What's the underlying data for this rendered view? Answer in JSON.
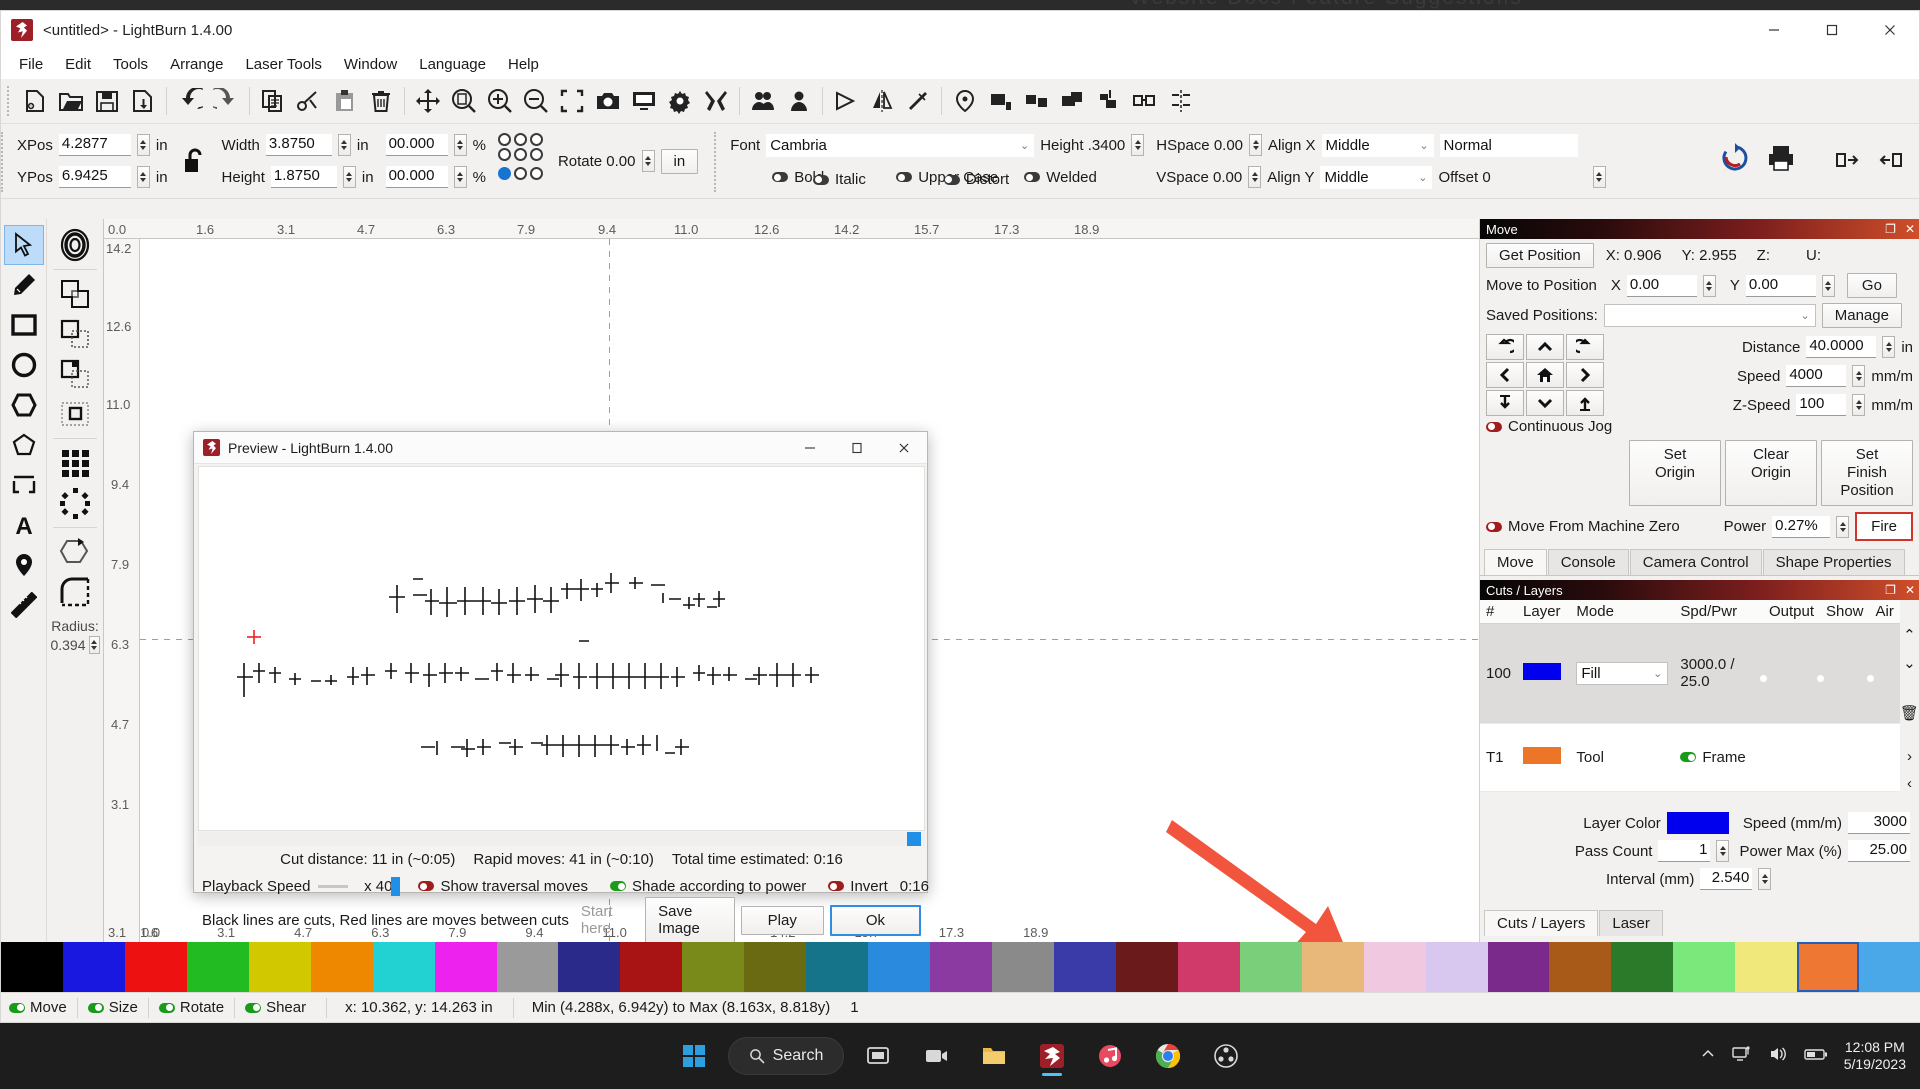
{
  "background_window": {
    "tabs_text": "Website    Docs    Feature Suggestions"
  },
  "window": {
    "title": "<untitled> - LightBurn 1.4.00",
    "controls": {
      "minimize": "minimize-icon",
      "maximize": "maximize-icon",
      "close": "close-icon"
    }
  },
  "menubar": {
    "items": [
      "File",
      "Edit",
      "Tools",
      "Arrange",
      "Laser Tools",
      "Window",
      "Language",
      "Help"
    ]
  },
  "toolbar": {
    "icons": [
      "new-file-icon",
      "open-file-icon",
      "save-icon",
      "save-as-icon",
      "undo-icon",
      "redo-icon",
      "copy-icon",
      "cut-icon",
      "paste-icon",
      "delete-icon",
      "move-icon",
      "zoom-fit-icon",
      "zoom-in-icon",
      "zoom-out-icon",
      "frame-selection-icon",
      "camera-icon",
      "monitor-icon",
      "settings-icon",
      "device-settings-icon",
      "group-icon",
      "ungroup-icon",
      "mirror-icon",
      "flip-horizontal-icon",
      "flip-vertical-icon",
      "node-edit-icon",
      "offset-icon",
      "weld-icon",
      "boolean-union-icon",
      "boolean-subtract-icon",
      "array-icon",
      "align-icon"
    ]
  },
  "properties": {
    "xpos_label": "XPos",
    "xpos_value": "4.2877",
    "xpos_unit": "in",
    "ypos_label": "YPos",
    "ypos_value": "6.9425",
    "ypos_unit": "in",
    "width_label": "Width",
    "width_value": "3.8750",
    "width_unit": "in",
    "height_label": "Height",
    "height_value": "1.8750",
    "height_unit": "in",
    "width_pct": "00.000",
    "height_pct": "00.000",
    "pct_unit": "%",
    "rotate_label": "Rotate 0.00",
    "rotate_unit": "in",
    "lock_icon": "unlocked-padlock-icon"
  },
  "text_toolbar": {
    "font_label": "Font",
    "font_value": "Cambria",
    "height_label": "Height .3400",
    "bold": "Bold",
    "italic": "Italic",
    "upper_case": "Upper Case",
    "distort": "Distort",
    "welded": "Welded",
    "hspace": "HSpace 0.00",
    "vspace": "VSpace 0.00",
    "align_x": "Align X",
    "align_x_value": "Middle",
    "align_y": "Align Y",
    "align_y_value": "Middle",
    "normal": "Normal",
    "offset": "Offset 0"
  },
  "left_tools": {
    "primary": [
      "select-arrow-icon",
      "pencil-draw-icon",
      "rectangle-icon",
      "ellipse-icon",
      "polygon-icon",
      "pen-path-icon",
      "bracket-frame-icon",
      "text-tool-icon",
      "position-pin-icon",
      "measure-ruler-icon"
    ],
    "secondary": [
      "offset-shapes-icon",
      "boolean-union-icon",
      "boolean-subtract-icon",
      "boolean-intersect-icon",
      "boolean-xor-icon",
      "grid-array-icon",
      "circular-array-icon",
      "edit-nodes-icon",
      "round-corner-icon"
    ],
    "radius_label": "Radius:",
    "radius_value": "0.394"
  },
  "rulers": {
    "horizontal": [
      "0.0",
      "1.6",
      "3.1",
      "4.7",
      "6.3",
      "7.9",
      "9.4",
      "11.0",
      "12.6",
      "14.2",
      "15.7",
      "17.3",
      "18.9"
    ],
    "vertical": [
      "14.2",
      "12.6",
      "11.0",
      "9.4",
      "7.9",
      "6.3",
      "4.7",
      "3.1"
    ],
    "origin_left": "0.0",
    "origin_bottom": "0.0"
  },
  "preview_dialog": {
    "title": "Preview - LightBurn 1.4.00",
    "stats": {
      "cut_distance": "Cut distance: 11 in (~0:05)",
      "rapid_moves": "Rapid moves: 41 in (~0:10)",
      "total_time": "Total time estimated: 0:16"
    },
    "playback_speed_label": "Playback Speed",
    "playback_multiplier": "x 40",
    "show_traversal": "Show traversal moves",
    "show_traversal_state": "off",
    "shade_power": "Shade according to power",
    "shade_power_state": "on",
    "invert": "Invert",
    "invert_state": "off",
    "invert_time": "0:16",
    "legend": "Black lines are cuts, Red lines are moves between cuts",
    "buttons": {
      "start_here": "Start here",
      "save_image": "Save Image",
      "play": "Play",
      "ok": "Ok"
    }
  },
  "move_panel": {
    "header": "Move",
    "get_position": "Get Position",
    "pos_x": "X: 0.906",
    "pos_y": "Y: 2.955",
    "pos_z": "Z:",
    "pos_u": "U:",
    "move_to_position": "Move to Position",
    "move_x_label": "X",
    "move_x_value": "0.00",
    "move_y_label": "Y",
    "move_y_value": "0.00",
    "go": "Go",
    "saved_positions_label": "Saved Positions:",
    "saved_positions_value": "",
    "manage": "Manage",
    "distance_label": "Distance",
    "distance_value": "40.0000",
    "distance_unit": "in",
    "speed_label": "Speed",
    "speed_value": "4000",
    "speed_unit": "mm/m",
    "zspeed_label": "Z-Speed",
    "zspeed_value": "100",
    "zspeed_unit": "mm/m",
    "continuous_jog": "Continuous Jog",
    "continuous_jog_state": "off",
    "set_origin": "Set Origin",
    "clear_origin": "Clear Origin",
    "set_finish_position": "Set Finish Position",
    "move_from_machine_zero": "Move From Machine Zero",
    "move_from_machine_zero_state": "off",
    "power_label": "Power",
    "power_value": "0.27%",
    "fire": "Fire",
    "jog_icons": [
      "rotate-ccw-icon",
      "jog-up-icon",
      "rotate-cw-icon",
      "jog-left-icon",
      "home-icon",
      "jog-right-icon",
      "z-down-icon",
      "jog-down-icon",
      "z-up-icon"
    ],
    "tabs": [
      "Move",
      "Console",
      "Camera Control",
      "Shape Properties"
    ],
    "active_tab": "Move"
  },
  "cuts_panel": {
    "header": "Cuts / Layers",
    "columns": [
      "#",
      "Layer",
      "Mode",
      "Spd/Pwr",
      "Output",
      "Show",
      "Air"
    ],
    "rows": [
      {
        "num": "100",
        "color": "#0000ee",
        "mode": "Fill",
        "spd_pwr": "3000.0 / 25.0",
        "output": "on",
        "show": "on",
        "air": "on",
        "selected": true
      },
      {
        "num": "T1",
        "color": "#ec7527",
        "mode": "Tool",
        "spd_pwr": "Frame",
        "frame_toggle": "on",
        "output": "",
        "show": "on",
        "air": "",
        "selected": false
      }
    ],
    "settings": {
      "layer_color_label": "Layer Color",
      "layer_color_value": "#0000ee",
      "speed_label": "Speed (mm/m)",
      "speed_value": "3000",
      "pass_count_label": "Pass Count",
      "pass_count_value": "1",
      "power_max_label": "Power Max (%)",
      "power_max_value": "25.00",
      "interval_label": "Interval (mm)",
      "interval_value": "2.540"
    },
    "tabs": [
      "Cuts / Layers",
      "Laser"
    ],
    "active_tab": "Cuts / Layers"
  },
  "status_bar": {
    "toggles": [
      {
        "label": "Move",
        "state": "on"
      },
      {
        "label": "Size",
        "state": "on"
      },
      {
        "label": "Rotate",
        "state": "on"
      },
      {
        "label": "Shear",
        "state": "on"
      }
    ],
    "cursor": "x: 10.362, y: 14.263 in",
    "bounds": "Min (4.288x, 6.942y) to Max (8.163x, 8.818y)",
    "count": "1"
  },
  "palette": {
    "colors": [
      "#000000",
      "#1818e0",
      "#ee1111",
      "#22bb22",
      "#d2c800",
      "#ee8800",
      "#22d2d2",
      "#ee22ee",
      "#9a9a9a",
      "#2a2a8a",
      "#a81414",
      "#7a8a1a",
      "#6a6a12",
      "#16748a",
      "#2a8ade",
      "#8a3aa0",
      "#8a8a8a",
      "#3a3aa8",
      "#6a1a1a",
      "#d03a6a",
      "#7ad07a",
      "#e8b87a",
      "#f0c8e0",
      "#d8c8f0",
      "#7a2a8a",
      "#a85a18",
      "#2a7a2a",
      "#7ae87a",
      "#f0e87a",
      "#ee7733",
      "#4aa8e8"
    ],
    "selected_index": 29
  },
  "taskbar": {
    "items": [
      "start-windows-icon",
      "search",
      "task-view-icon",
      "teams-icon",
      "file-explorer-icon",
      "lightburn-icon",
      "music-icon",
      "chrome-icon",
      "settings-icon"
    ],
    "search_label": "Search",
    "tray_icons": [
      "chevron-up-icon",
      "network-icon",
      "volume-icon",
      "battery-icon"
    ],
    "clock_time": "12:08 PM",
    "clock_date": "5/19/2023"
  },
  "colors": {
    "accent_blue": "#1f8fe8",
    "panel_header_start": "#060606",
    "panel_header_end": "#cf4e2a",
    "fire_red": "#d0342c",
    "arrow_red": "#f2553d"
  }
}
